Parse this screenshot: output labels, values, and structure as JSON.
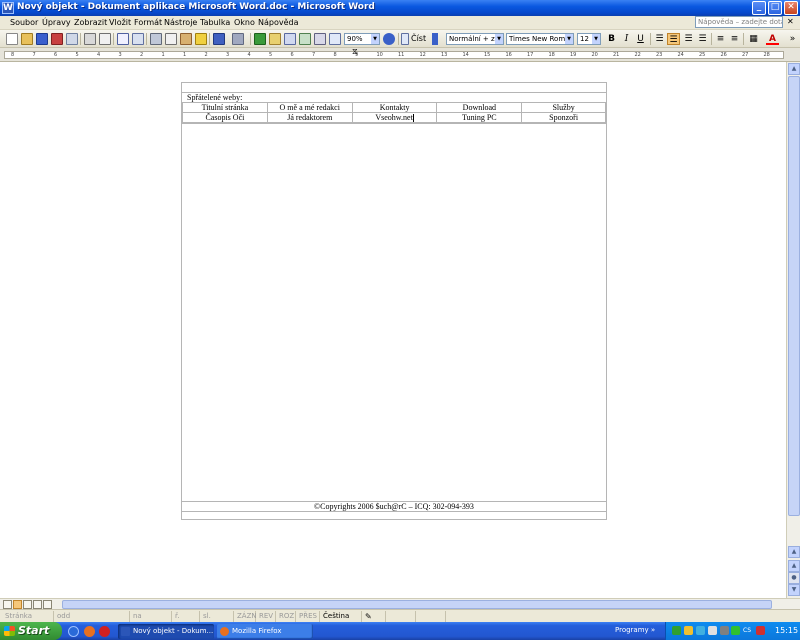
{
  "window": {
    "title": "Nový objekt - Dokument aplikace Microsoft Word.doc - Microsoft Word",
    "app_icon_letter": "W",
    "controls": {
      "minimize": "_",
      "maximize": "□",
      "close": "✕"
    }
  },
  "menubar": {
    "items": [
      "Soubor",
      "Úpravy",
      "Zobrazit",
      "Vložit",
      "Formát",
      "Nástroje",
      "Tabulka",
      "Okno",
      "Nápověda"
    ],
    "help_placeholder": "Nápověda – zadejte dotaz",
    "close_doc": "✕"
  },
  "toolbar": {
    "zoom": "90%",
    "read_label": "Číst",
    "style": "Normální + zarc",
    "font": "Times New Roman",
    "font_size": "12",
    "bold": "B",
    "italic": "I",
    "underline": "U",
    "font_color_letter": "A"
  },
  "ruler": {
    "labels": [
      "8",
      "7",
      "6",
      "5",
      "4",
      "3",
      "2",
      "1",
      "1",
      "2",
      "3",
      "4",
      "5",
      "6",
      "7",
      "8",
      "9",
      "10",
      "11",
      "12",
      "13",
      "14",
      "15",
      "16",
      "17",
      "18",
      "19",
      "20",
      "21",
      "22",
      "23",
      "24",
      "25",
      "26",
      "27",
      "28"
    ]
  },
  "document": {
    "friends_label": "Spřátelené weby:",
    "nav_rows": [
      [
        "Titulní stránka",
        "O mě a mé redakci",
        "Kontakty",
        "Download",
        "Služby"
      ],
      [
        "Časopis Oči",
        "Já redaktorem",
        "Vseohw.net",
        "Tuning PC",
        "Sponzoři"
      ]
    ],
    "footer": "©Copyrights 2006 $uch@rC – ICQ: 302-094-393"
  },
  "statusbar": {
    "page": "Stránka",
    "section": "odd",
    "position": "na",
    "line": "ř.",
    "column": "sl.",
    "rec": "ZÁZN",
    "trk": "REV",
    "ext": "ROZ",
    "ovr": "PŘES",
    "language": "Čeština"
  },
  "taskbar": {
    "start_label": "Start",
    "tasks": [
      {
        "label": "Nový objekt - Dokum...",
        "active": true
      },
      {
        "label": "Mozilla Firefox",
        "active": false
      }
    ],
    "programs_label": "Programy",
    "language": "CS",
    "clock": "15:15"
  },
  "colors": {
    "title_bar": "#0a58e0",
    "taskbar": "#245edb",
    "start_button": "#318a31",
    "active_button": "#f5c77a"
  }
}
